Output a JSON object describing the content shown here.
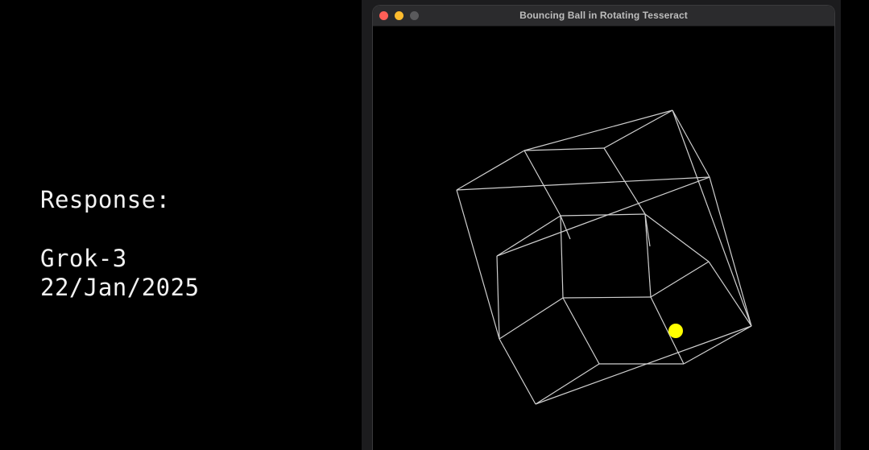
{
  "caption": {
    "label": "Response:",
    "model": "Grok-3",
    "date": "22/Jan/2025"
  },
  "window": {
    "title": "Bouncing Ball in Rotating Tesseract"
  },
  "scene": {
    "edge_color": "#cfcfcf",
    "ball_color": "#ffff00",
    "background_color": "#000000"
  }
}
